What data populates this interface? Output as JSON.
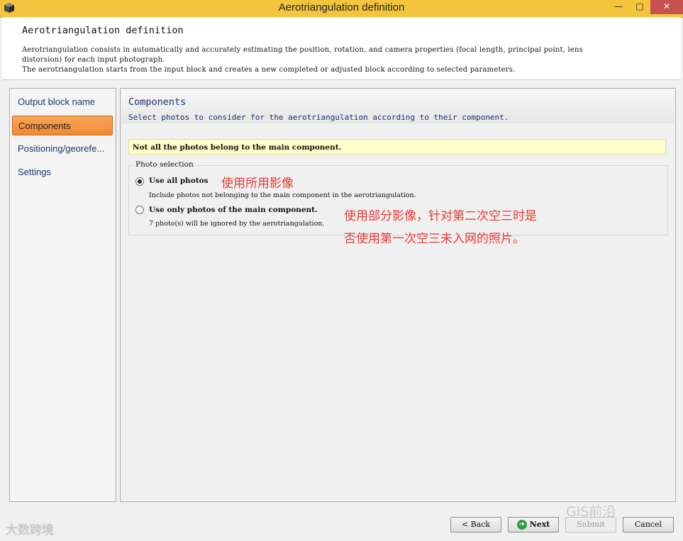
{
  "window": {
    "title": "Aerotriangulation definition",
    "controls": {
      "minimize": "—",
      "maximize": "□",
      "close": "✕"
    }
  },
  "header": {
    "title": "Aerotriangulation definition",
    "desc_line1": "Aerotriangulation consists in automatically and accurately estimating the position, rotation, and camera properties (focal length, principal point, lens",
    "desc_line2": "distorsion) for each input photograph.",
    "desc_line3": "The aerotriangulation starts from the input block and creates a new completed or adjusted block according to selected parameters."
  },
  "sidebar": {
    "items": [
      {
        "label": "Output block name"
      },
      {
        "label": "Components",
        "active": true
      },
      {
        "label": "Positioning/georefe..."
      },
      {
        "label": "Settings"
      }
    ]
  },
  "content": {
    "title": "Components",
    "subtitle": "Select photos to consider for the aerotriangulation according to their component.",
    "warning": "Not all the photos belong to the main component.",
    "photo_selection": {
      "legend": "Photo selection",
      "options": [
        {
          "label": "Use all photos",
          "desc": "Include photos not belonging to the main component in the aerotriangulation.",
          "checked": true
        },
        {
          "label": "Use only photos of the main component.",
          "desc": "7 photo(s) will be ignored by the aerotriangulation.",
          "checked": false
        }
      ]
    }
  },
  "annotations": {
    "note1": "使用所用影像",
    "note2_line1": "使用部分影像，针对第二次空三时是",
    "note2_line2": "否使用第一次空三未入网的照片。",
    "color": "#e63a34"
  },
  "footer": {
    "back": "< Back",
    "next": "Next",
    "submit": "Submit",
    "cancel": "Cancel"
  },
  "watermarks": {
    "left": "大数跨境",
    "right": "GIS前沿"
  },
  "colors": {
    "titlebar": "#f4c43c",
    "active_nav": "#ee8a34",
    "warning_bg": "#fffdc8",
    "link_blue": "#1b2f6e"
  }
}
